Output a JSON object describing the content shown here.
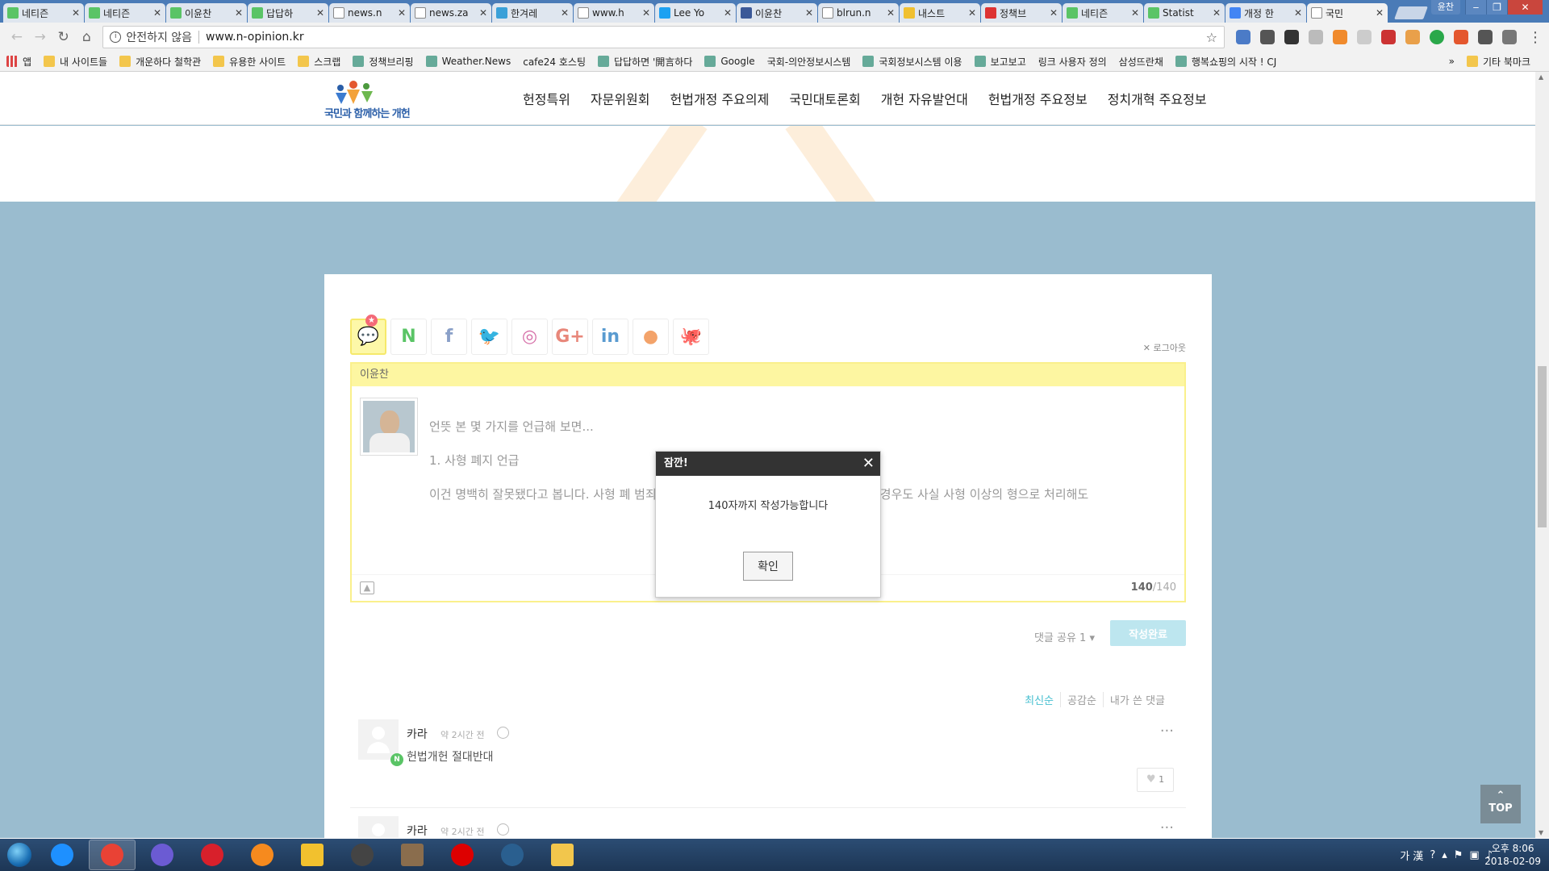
{
  "browser": {
    "tabs": [
      {
        "label": "네티즌",
        "color": "#5ac466"
      },
      {
        "label": "네티즌",
        "color": "#5ac466"
      },
      {
        "label": "이윤찬",
        "color": "#5ac466"
      },
      {
        "label": "답답하",
        "color": "#5ac466"
      },
      {
        "label": "news.n",
        "color": "#ffffff"
      },
      {
        "label": "news.za",
        "color": "#ffffff"
      },
      {
        "label": "한겨레",
        "color": "#3aa0d8"
      },
      {
        "label": "www.h",
        "color": "#ffffff"
      },
      {
        "label": "Lee Yo",
        "color": "#1da1f2"
      },
      {
        "label": "이윤찬",
        "color": "#3b5998"
      },
      {
        "label": "blrun.n",
        "color": "#ffffff"
      },
      {
        "label": "내스트",
        "color": "#f0c030"
      },
      {
        "label": "정책브",
        "color": "#d33"
      },
      {
        "label": "네티즌",
        "color": "#5ac466"
      },
      {
        "label": "Statist",
        "color": "#5ac466"
      },
      {
        "label": "개정 한",
        "color": "#4285f4"
      },
      {
        "label": "국민",
        "color": "#ffffff",
        "active": true
      }
    ],
    "user_label": "윤찬",
    "security_label": "안전하지 않음",
    "url": "www.n-opinion.kr",
    "bookmarks": [
      {
        "label": "앱",
        "type": "apps"
      },
      {
        "label": "내 사이트들",
        "type": "folder"
      },
      {
        "label": "개운하다 철학관",
        "type": "folder"
      },
      {
        "label": "유용한 사이트",
        "type": "folder"
      },
      {
        "label": "스크랩",
        "type": "folder"
      },
      {
        "label": "정책브리핑",
        "type": "site"
      },
      {
        "label": "Weather.News",
        "type": "site"
      },
      {
        "label": "cafe24 호스팅",
        "type": "page"
      },
      {
        "label": "답답하면 '開言하다",
        "type": "site"
      },
      {
        "label": "Google",
        "type": "site"
      },
      {
        "label": "국회-의안정보시스템",
        "type": "page"
      },
      {
        "label": "국회정보시스템 이용",
        "type": "site"
      },
      {
        "label": "보고보고",
        "type": "site"
      },
      {
        "label": "링크 사용자 정의",
        "type": "page"
      },
      {
        "label": "삼성뜨란채",
        "type": "page"
      },
      {
        "label": "행복쇼핑의 시작 ! CJ",
        "type": "site"
      }
    ],
    "more_bookmarks": "»",
    "other_bookmarks": "기타 북마크"
  },
  "site": {
    "logo_text": "국민과 함께하는 개헌",
    "nav": [
      "헌정특위",
      "자문위원회",
      "헌법개정 주요의제",
      "국민대토론회",
      "개헌 자유발언대",
      "헌법개정 주요정보",
      "정치개혁 주요정보"
    ]
  },
  "comment_box": {
    "sns": [
      {
        "name": "talk",
        "glyph": "💬",
        "color": "#555",
        "active": true,
        "badge": "★"
      },
      {
        "name": "naver",
        "glyph": "N",
        "color": "#5ac466"
      },
      {
        "name": "facebook",
        "glyph": "f",
        "color": "#8aa0c8"
      },
      {
        "name": "twitter",
        "glyph": "🐦",
        "color": "#8ecbea"
      },
      {
        "name": "instagram",
        "glyph": "◎",
        "color": "#d66fa8"
      },
      {
        "name": "google-plus",
        "glyph": "G+",
        "color": "#e8877a"
      },
      {
        "name": "linkedin",
        "glyph": "in",
        "color": "#5a9bd0"
      },
      {
        "name": "kakao",
        "glyph": "●",
        "color": "#f3a36a"
      },
      {
        "name": "github",
        "glyph": "🐙",
        "color": "#666"
      }
    ],
    "logout_label": "✕ 로그아웃",
    "user_name": "이윤찬",
    "text_lines": [
      "언뜻 본 몇 가지를 언급해 보면...",
      "1. 사형 폐지 언급",
      "이건 명백히 잘못됐다고 봅니다. 사형 폐                                                        범죄를 저지른 현행범이나 미성년자 성폭행 같은 경우도 사실 사형 이상의 형으로 처리해도"
    ],
    "count_current": "140",
    "count_max": "/140",
    "share_label": "댓글 공유 1 ▾",
    "submit_label": "작성완료",
    "sort_options": [
      "최신순",
      "공감순",
      "내가 쓴 댓글"
    ]
  },
  "comments": [
    {
      "name": "카라",
      "time": "약 2시간 전",
      "body": "헌법개헌 절대반대",
      "likes": "1"
    },
    {
      "name": "카라",
      "time": "약 2시간 전",
      "body": "",
      "likes": ""
    }
  ],
  "modal": {
    "title": "잠깐!",
    "close": "✕",
    "message": "140자까지 작성가능합니다",
    "ok_label": "확인"
  },
  "top_button": {
    "arrow": "⌃",
    "label": "TOP"
  },
  "taskbar": {
    "apps": [
      {
        "name": "ie",
        "color": "#1e90ff"
      },
      {
        "name": "chrome",
        "color": "#e94235",
        "active": true
      },
      {
        "name": "s-app",
        "color": "#6b5bd3"
      },
      {
        "name": "opera",
        "color": "#d8202b"
      },
      {
        "name": "firefox",
        "color": "#f68a1e"
      },
      {
        "name": "tool",
        "color": "#f2c12e"
      },
      {
        "name": "bot",
        "color": "#444"
      },
      {
        "name": "book",
        "color": "#8a6d4d"
      },
      {
        "name": "record",
        "color": "#d00"
      },
      {
        "name": "dove",
        "color": "#2a5f8f"
      },
      {
        "name": "explorer",
        "color": "#f2c64c"
      }
    ],
    "ime": "가 漢",
    "time": "오후 8:06",
    "date": "2018-02-09"
  }
}
